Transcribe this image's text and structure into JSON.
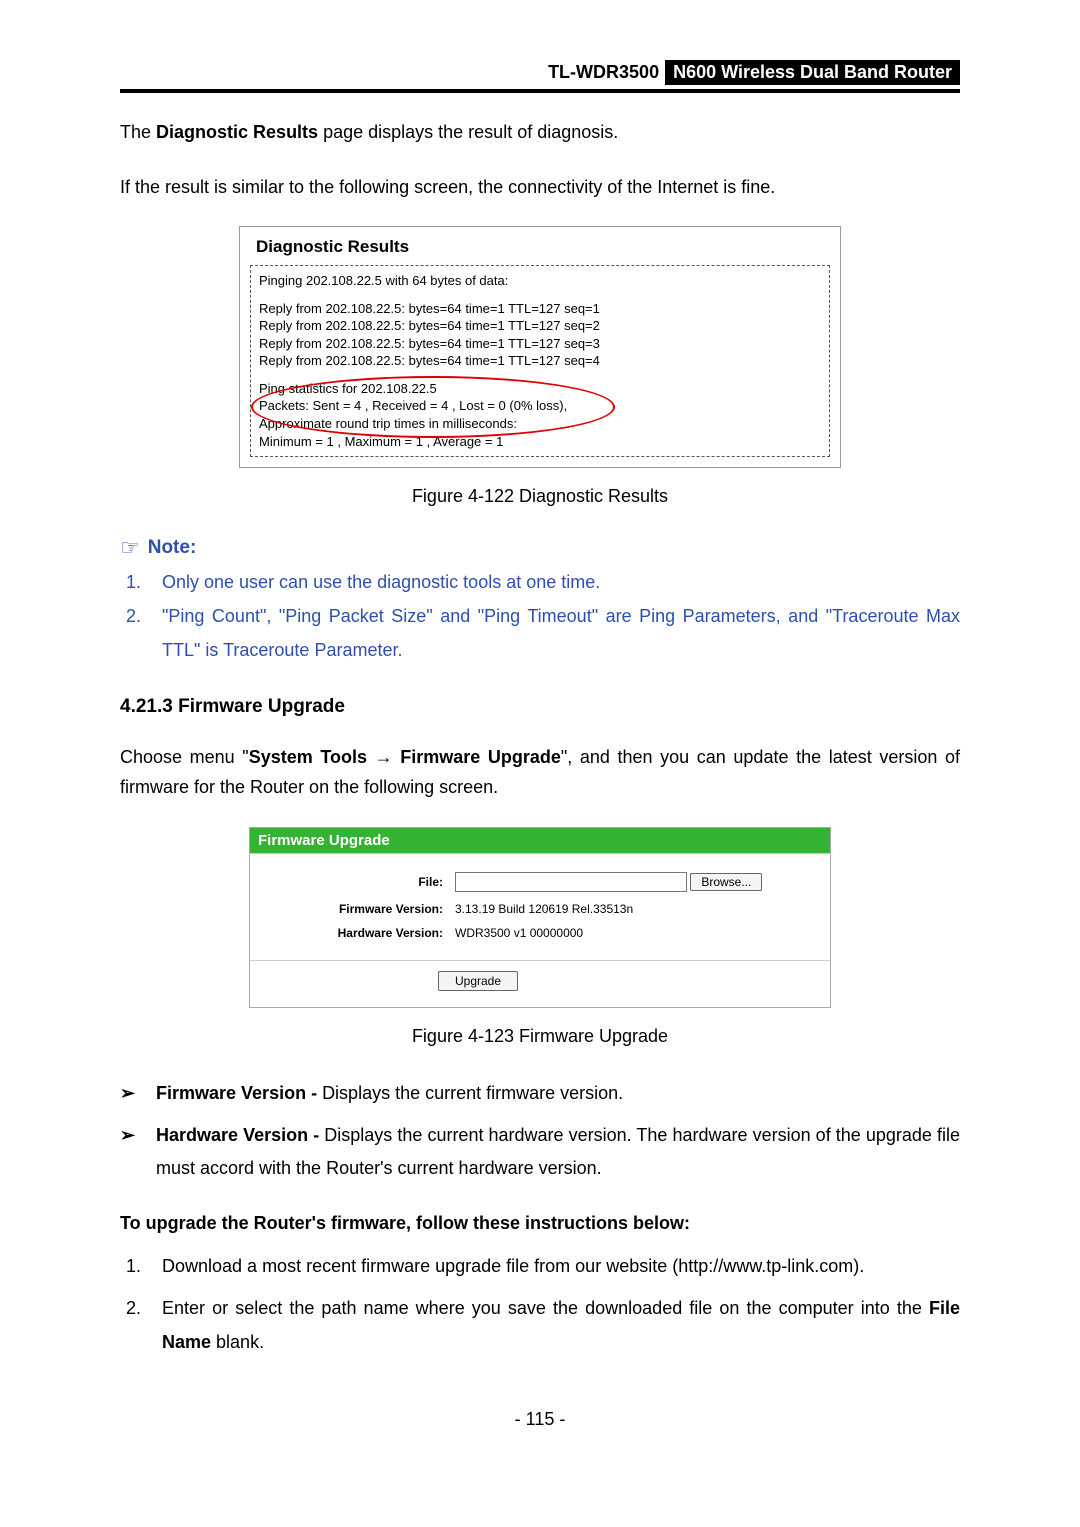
{
  "header": {
    "model": "TL-WDR3500",
    "product": "N600 Wireless Dual Band Router"
  },
  "intro": {
    "p1_pre": "The ",
    "p1_bold": "Diagnostic Results",
    "p1_post": " page displays the result of diagnosis.",
    "p2": "If the result is similar to the following screen, the connectivity of the Internet is fine."
  },
  "diag": {
    "title": "Diagnostic Results",
    "pinging": "Pinging 202.108.22.5 with 64 bytes of data:",
    "replies": [
      "Reply from 202.108.22.5:  bytes=64  time=1  TTL=127  seq=1",
      "Reply from 202.108.22.5:  bytes=64  time=1  TTL=127  seq=2",
      "Reply from 202.108.22.5:  bytes=64  time=1  TTL=127  seq=3",
      "Reply from 202.108.22.5:  bytes=64  time=1  TTL=127  seq=4"
    ],
    "stats_title": "Ping statistics for 202.108.22.5",
    "packets": " Packets: Sent = 4 , Received = 4 , Lost = 0 (0% loss),",
    "approx": "Approximate round trip times in milliseconds:",
    "minmax": " Minimum = 1 , Maximum = 1 , Average = 1"
  },
  "captions": {
    "fig122": "Figure 4-122 Diagnostic Results",
    "fig123": "Figure 4-123 Firmware Upgrade"
  },
  "note": {
    "label": "Note:",
    "items": [
      "Only one user can use the diagnostic tools at one time.",
      "\"Ping Count\", \"Ping Packet Size\" and \"Ping Timeout\" are Ping Parameters, and \"Traceroute Max TTL\" is Traceroute Parameter."
    ]
  },
  "section": {
    "heading": "4.21.3   Firmware Upgrade",
    "p_pre": "Choose menu \"",
    "p_bold1": "System Tools",
    "p_arrow": " → ",
    "p_bold2": "Firmware Upgrade",
    "p_post": "\", and then you can update the latest version of firmware for the Router on the following screen."
  },
  "fw": {
    "title": "Firmware Upgrade",
    "file_label": "File:",
    "browse": "Browse...",
    "fw_ver_label": "Firmware Version:",
    "fw_ver_value": "3.13.19 Build 120619 Rel.33513n",
    "hw_ver_label": "Hardware Version:",
    "hw_ver_value": "WDR3500 v1 00000000",
    "upgrade": "Upgrade"
  },
  "bullets": {
    "b1_bold": "Firmware Version - ",
    "b1_text": "Displays the current firmware version.",
    "b2_bold": "Hardware Version - ",
    "b2_text": "Displays the current hardware version. The hardware version of the upgrade file must accord with the Router's current hardware version."
  },
  "upgrade_instr": {
    "heading": "To upgrade the Router's firmware, follow these instructions below:",
    "s1": "Download a most recent firmware upgrade file from our website (http://www.tp-link.com).",
    "s2_pre": "Enter or select the path name where you save the downloaded file on the computer into the ",
    "s2_bold": "File Name",
    "s2_post": " blank."
  },
  "footer": {
    "page": "- 115 -"
  }
}
